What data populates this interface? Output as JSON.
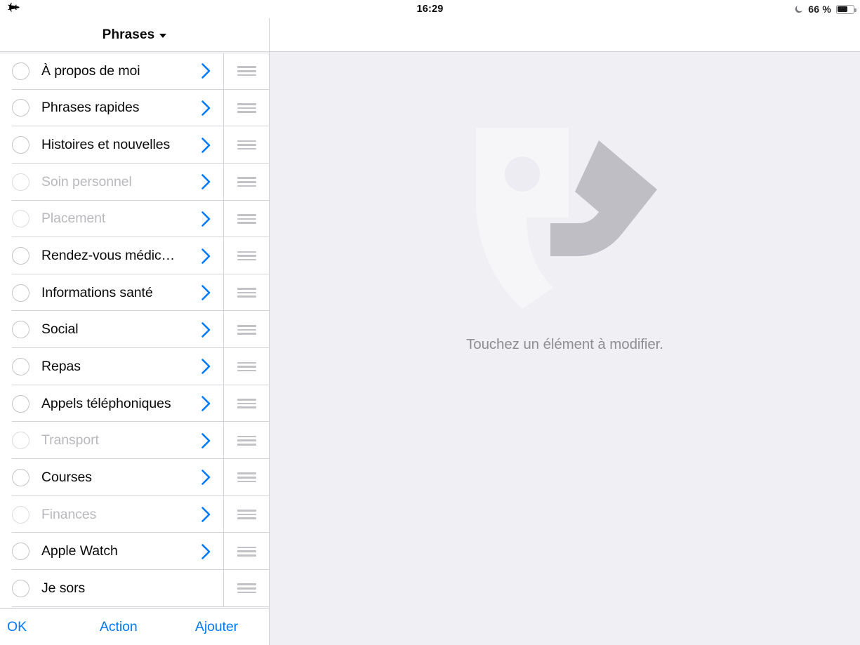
{
  "status_bar": {
    "airplane_icon": "airplane-mode-icon",
    "time": "16:29",
    "dnd_icon": "moon-do-not-disturb-icon",
    "battery_percent_label": "66 %",
    "battery_level": 66
  },
  "left_pane": {
    "nav": {
      "title": "Phrases",
      "caret_icon": "chevron-down-icon"
    },
    "rows": [
      {
        "label": "À propos de moi",
        "dimmed": false,
        "has_chevron": true,
        "selected": false
      },
      {
        "label": "Phrases rapides",
        "dimmed": false,
        "has_chevron": true,
        "selected": false
      },
      {
        "label": "Histoires et nouvelles",
        "dimmed": false,
        "has_chevron": true,
        "selected": false
      },
      {
        "label": "Soin personnel",
        "dimmed": true,
        "has_chevron": true,
        "selected": false
      },
      {
        "label": "Placement",
        "dimmed": true,
        "has_chevron": true,
        "selected": false
      },
      {
        "label": "Rendez-vous médic…",
        "dimmed": false,
        "has_chevron": true,
        "selected": false
      },
      {
        "label": "Informations santé",
        "dimmed": false,
        "has_chevron": true,
        "selected": false
      },
      {
        "label": "Social",
        "dimmed": false,
        "has_chevron": true,
        "selected": false
      },
      {
        "label": "Repas",
        "dimmed": false,
        "has_chevron": true,
        "selected": false
      },
      {
        "label": "Appels téléphoniques",
        "dimmed": false,
        "has_chevron": true,
        "selected": false
      },
      {
        "label": "Transport",
        "dimmed": true,
        "has_chevron": true,
        "selected": false
      },
      {
        "label": "Courses",
        "dimmed": false,
        "has_chevron": true,
        "selected": false
      },
      {
        "label": "Finances",
        "dimmed": true,
        "has_chevron": true,
        "selected": false
      },
      {
        "label": "Apple Watch",
        "dimmed": false,
        "has_chevron": true,
        "selected": false
      },
      {
        "label": "Je sors",
        "dimmed": false,
        "has_chevron": false,
        "selected": false
      }
    ],
    "toolbar": {
      "ok_label": "OK",
      "action_label": "Action",
      "add_label": "Ajouter"
    }
  },
  "right_pane": {
    "empty_state_text": "Touchez un élément à modifier.",
    "watermark_icon": "speech-mask-logo-watermark"
  },
  "colors": {
    "accent_blue": "#007aff",
    "detail_background": "#efeff4",
    "separator": "#d3d3d7",
    "dim_text": "#b9b9bd",
    "empty_text": "#8e8e93",
    "logo_light": "#f6f6f8",
    "logo_dark": "#bebec4"
  }
}
